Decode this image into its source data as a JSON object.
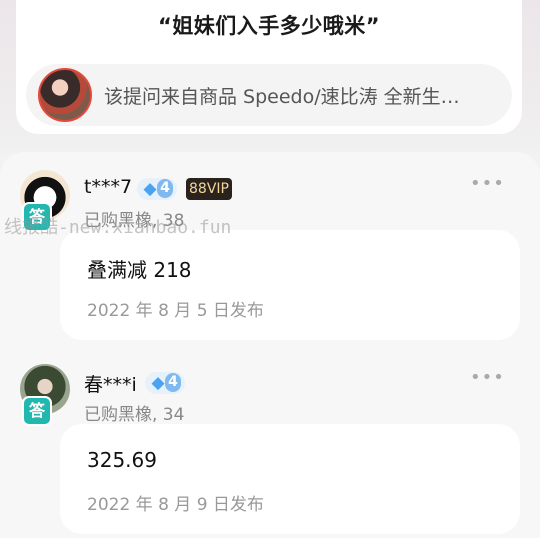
{
  "question": {
    "title": "“姐妹们入手多少哦米”",
    "product_ref": "该提问来自商品 Speedo/速比涛 全新生…"
  },
  "answers": [
    {
      "username": "t***7",
      "level": "4",
      "vip": "88VIP",
      "badge": "答",
      "bought": "已购黑橡, 38",
      "text": "叠满减 218",
      "date": "2022 年 8 月 5 日发布",
      "more": "•••"
    },
    {
      "username": "春***i",
      "level": "4",
      "badge": "答",
      "bought": "已购黑橡, 34",
      "text": "325.69",
      "date": "2022 年 8 月 9 日发布",
      "more": "•••"
    }
  ],
  "watermark": "线报酷-new.xianbao.fun",
  "icons": {
    "level_icon": "diamond-icon",
    "more_icon": "more-dots-icon"
  },
  "colors": {
    "answer_badge": "#22b8b0",
    "vip_bg": "#2a221c",
    "vip_text": "#f2d59b",
    "diamond": "#4aa3f0"
  }
}
